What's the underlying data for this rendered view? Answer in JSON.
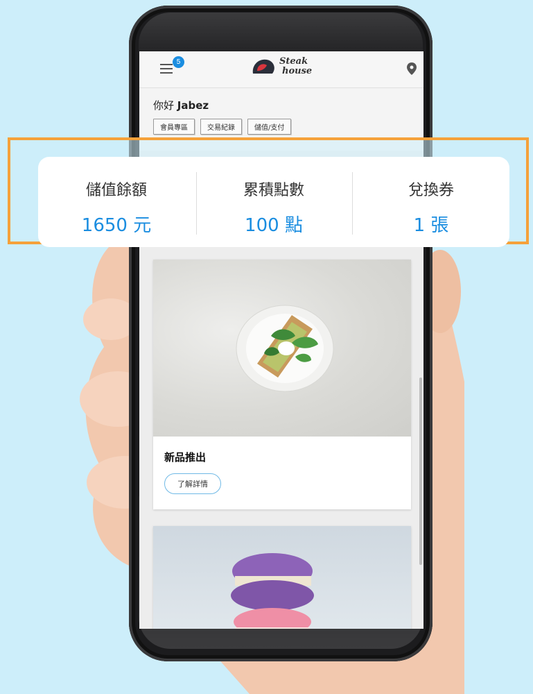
{
  "app": {
    "logo_text": [
      "Steak",
      "house"
    ],
    "notification_count": "5"
  },
  "user": {
    "greeting_prefix": "你好",
    "name": "Jabez"
  },
  "member_tabs": [
    "會員專區",
    "交易紀錄",
    "儲值/支付"
  ],
  "stats": [
    {
      "label": "儲值餘額",
      "value": "1650 元"
    },
    {
      "label": "累積點數",
      "value": "100 點"
    },
    {
      "label": "兌換券",
      "value": "1 張"
    }
  ],
  "promo_card": {
    "title": "新品推出",
    "button_label": "了解詳情"
  },
  "colors": {
    "accent": "#1a8de0",
    "highlight_border": "#f5a13a",
    "background": "#cdeefa"
  }
}
